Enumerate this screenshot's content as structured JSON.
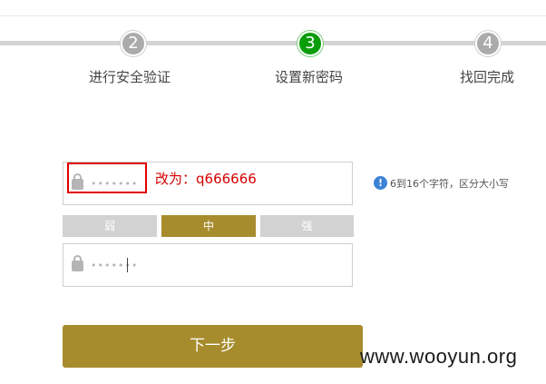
{
  "steps": [
    {
      "number": "2",
      "label": "进行安全验证"
    },
    {
      "number": "3",
      "label": "设置新密码"
    },
    {
      "number": "4",
      "label": "找回完成"
    }
  ],
  "password_field": {
    "masked_value": "•••••••"
  },
  "annotation": {
    "text": "改为：q666666",
    "color": "#d40000"
  },
  "hint": {
    "icon": "!",
    "text": "6到16个字符，区分大小写"
  },
  "strength": {
    "weak": "弱",
    "medium": "中",
    "strong": "强",
    "current": "medium"
  },
  "confirm_field": {
    "masked_value": "•••••••"
  },
  "next_button": {
    "label": "下一步"
  },
  "watermark": {
    "text": "www.wooyun.org"
  },
  "colors": {
    "accent": "#a78c2e",
    "active_step": "#0a9d0a",
    "inactive_step": "#ababab",
    "annotation": "#d40000"
  }
}
